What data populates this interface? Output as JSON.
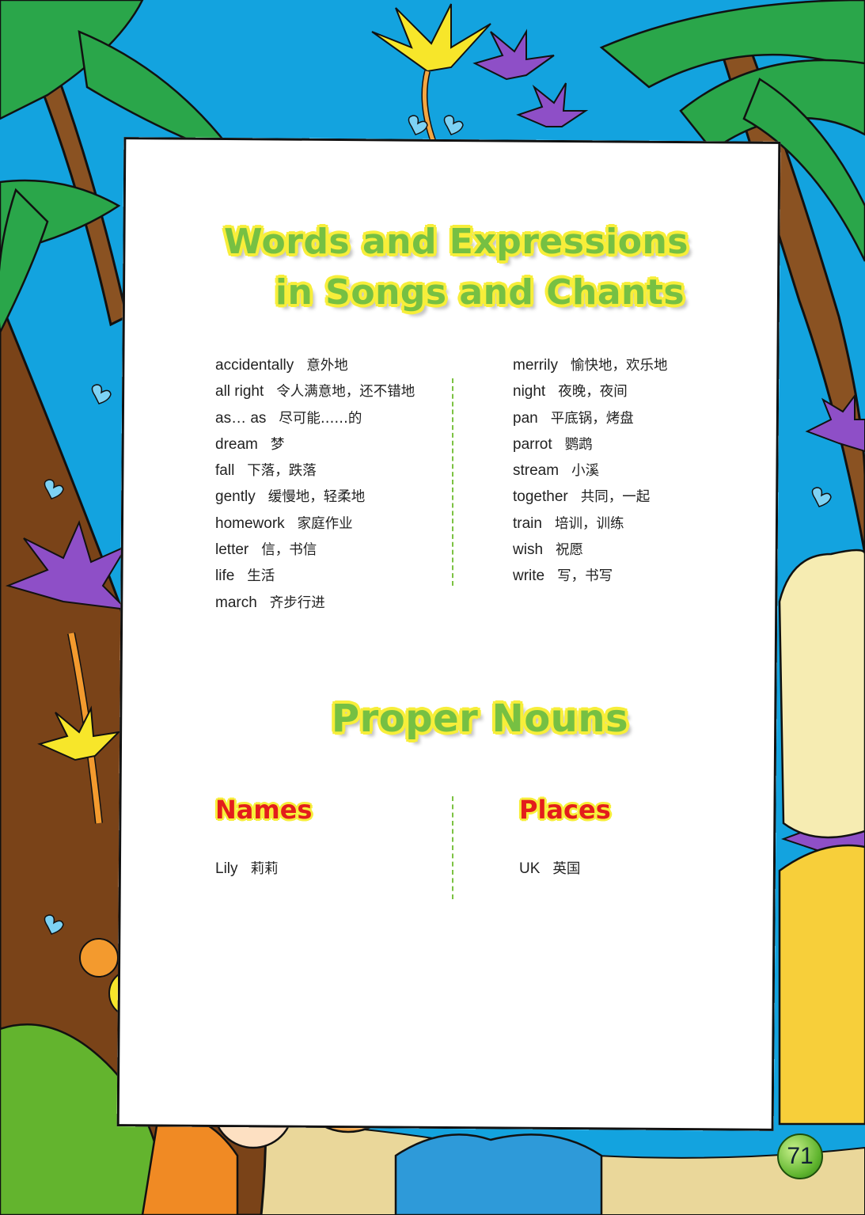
{
  "title": {
    "line1": "Words and Expressions",
    "line2": "in Songs and Chants",
    "proper_nouns": "Proper Nouns"
  },
  "vocab_left": [
    {
      "en": "accidentally",
      "zh": "意外地"
    },
    {
      "en": "all right",
      "zh": "令人满意地，还不错地"
    },
    {
      "en": "as… as",
      "zh": "尽可能……的"
    },
    {
      "en": "dream",
      "zh": "梦"
    },
    {
      "en": "fall",
      "zh": "下落，跌落"
    },
    {
      "en": "gently",
      "zh": "缓慢地，轻柔地"
    },
    {
      "en": "homework",
      "zh": "家庭作业"
    },
    {
      "en": "letter",
      "zh": "信，书信"
    },
    {
      "en": "life",
      "zh": "生活"
    },
    {
      "en": "march",
      "zh": "齐步行进"
    }
  ],
  "vocab_right": [
    {
      "en": "merrily",
      "zh": "愉快地，欢乐地"
    },
    {
      "en": "night",
      "zh": "夜晚，夜间"
    },
    {
      "en": "pan",
      "zh": "平底锅，烤盘"
    },
    {
      "en": "parrot",
      "zh": "鹦鹉"
    },
    {
      "en": "stream",
      "zh": "小溪"
    },
    {
      "en": "together",
      "zh": "共同，一起"
    },
    {
      "en": "train",
      "zh": "培训，训练"
    },
    {
      "en": "wish",
      "zh": "祝愿"
    },
    {
      "en": "write",
      "zh": "写，书写"
    }
  ],
  "names": {
    "heading": "Names",
    "items": [
      {
        "en": "Lily",
        "zh": "莉莉"
      }
    ]
  },
  "places": {
    "heading": "Places",
    "items": [
      {
        "en": "UK",
        "zh": "英国"
      }
    ]
  },
  "page_number": "71",
  "colors": {
    "sky": "#13a3df",
    "title_green": "#76c043",
    "title_glow": "#f7ee3a",
    "subheading_red": "#e31d1c",
    "divider": "#7cc242"
  }
}
